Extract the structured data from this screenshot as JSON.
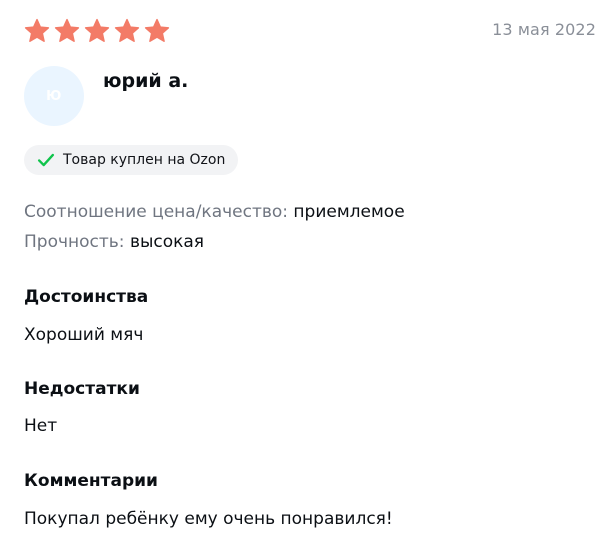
{
  "review": {
    "rating": 5,
    "rating_max": 5,
    "star_color": "#f37b67",
    "date": "13 мая 2022",
    "author": {
      "name": "юрий а.",
      "initials": "Ю",
      "avatar_color": "#eaf5ff"
    },
    "badge": {
      "label": "Товар куплен на Ozon",
      "check_color": "#10c44c"
    },
    "properties": [
      {
        "label": "Соотношение цена/качество:",
        "value": "приемлемое"
      },
      {
        "label": "Прочность:",
        "value": "высокая"
      }
    ],
    "sections": [
      {
        "title": "Достоинства",
        "text": "Хороший мяч"
      },
      {
        "title": "Недостатки",
        "text": "Нет"
      },
      {
        "title": "Комментарии",
        "text": "Покупал ребёнку ему очень понравился!"
      }
    ]
  }
}
